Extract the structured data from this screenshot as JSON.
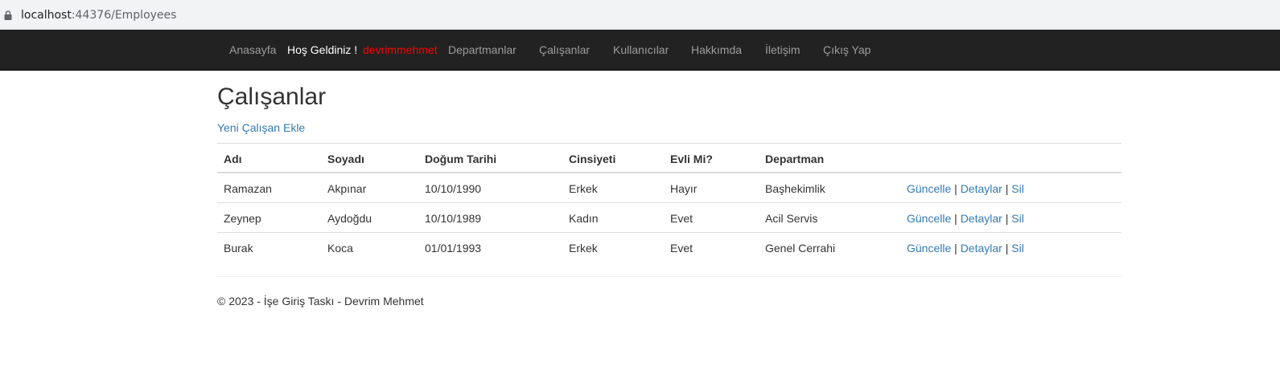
{
  "browser": {
    "url_host": "localhost",
    "url_rest": ":44376/Employees"
  },
  "navbar": {
    "home": "Anasayfa",
    "welcome": "Hoş Geldiniz !",
    "username": "devrimmehmet",
    "departments": "Departmanlar",
    "employees": "Çalışanlar",
    "users": "Kullanıcılar",
    "about": "Hakkımda",
    "contact": "İletişim",
    "logout": "Çıkış Yap"
  },
  "page": {
    "title": "Çalışanlar",
    "add_link": "Yeni Çalışan Ekle"
  },
  "table": {
    "headers": [
      "Adı",
      "Soyadı",
      "Doğum Tarihi",
      "Cinsiyeti",
      "Evli Mi?",
      "Departman"
    ],
    "rows": [
      [
        "Ramazan",
        "Akpınar",
        "10/10/1990",
        "Erkek",
        "Hayır",
        "Başhekimlik"
      ],
      [
        "Zeynep",
        "Aydoğdu",
        "10/10/1989",
        "Kadın",
        "Evet",
        "Acil Servis"
      ],
      [
        "Burak",
        "Koca",
        "01/01/1993",
        "Erkek",
        "Evet",
        "Genel Cerrahi"
      ]
    ],
    "actions": {
      "edit": "Güncelle",
      "details": "Detaylar",
      "delete": "Sil",
      "separator": "|"
    }
  },
  "footer": {
    "text": "© 2023 - İşe Giriş Taskı - Devrim Mehmet"
  },
  "colors": {
    "navbar_bg": "#222222",
    "link": "#337ab7",
    "username": "#ff0000"
  },
  "icons": {
    "lock": "lock-icon"
  }
}
